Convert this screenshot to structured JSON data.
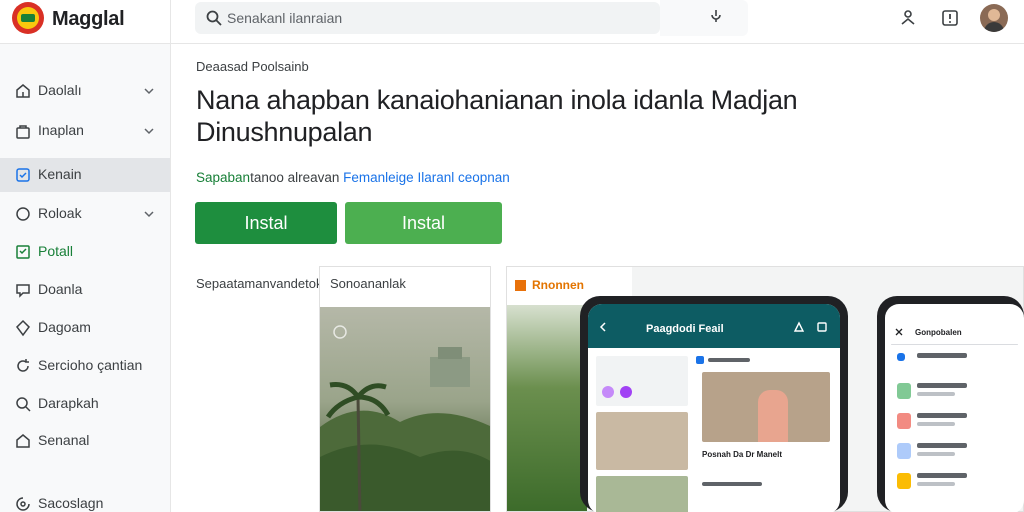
{
  "app": {
    "title": "Magglal"
  },
  "search": {
    "placeholder": "Senakanl ilanraian"
  },
  "sidebar": {
    "items": [
      {
        "label": "Daolalı",
        "icon": "home-icon",
        "chevron": true
      },
      {
        "label": "Inaplan",
        "icon": "bag-icon",
        "chevron": true
      },
      {
        "label": "Kenain",
        "icon": "app-icon",
        "chevron": false,
        "active": true
      },
      {
        "label": "Roloak",
        "icon": "circle-icon",
        "chevron": true
      },
      {
        "label": "Potall",
        "icon": "bookmark-icon",
        "chevron": false,
        "green": true
      },
      {
        "label": "Doanla",
        "icon": "chat-icon",
        "chevron": false
      },
      {
        "label": "Dagoam",
        "icon": "pin-icon",
        "chevron": false
      },
      {
        "label": "Sercioho çantian",
        "icon": "refresh-icon",
        "chevron": false
      },
      {
        "label": "Darapkah",
        "icon": "search-icon",
        "chevron": false
      },
      {
        "label": "Senanal",
        "icon": "house-icon",
        "chevron": false
      },
      {
        "label": "Sacoslagn",
        "icon": "settings-icon",
        "chevron": false
      }
    ]
  },
  "main": {
    "breadcrumb": "Deaasad Poolsainb",
    "title": "Nana ahapban kanaiohanianan inola idanla Madjan Dinushnupalan",
    "subtitle": {
      "part1": "Sapaban",
      "part2": "tanoo alreavan",
      "part3": "Femanleige Ilaranl ceopnan"
    },
    "install_primary": "Instal",
    "install_secondary": "Instal",
    "screenshots_label": "Sepaatamanvandetok"
  },
  "cards": {
    "card1_title": "Sonoananlak",
    "card2_title": "Rnonnen",
    "phone1_title": "Paagdodi Feail",
    "phone1_caption": "Posnah Da Dr Manelt",
    "phone2_title": "Gonpobalen"
  },
  "colors": {
    "accent": "#1e8e3e",
    "secondary_button": "#4caf50",
    "link": "#1a73e8",
    "phone_appbar": "#0d5c63"
  }
}
